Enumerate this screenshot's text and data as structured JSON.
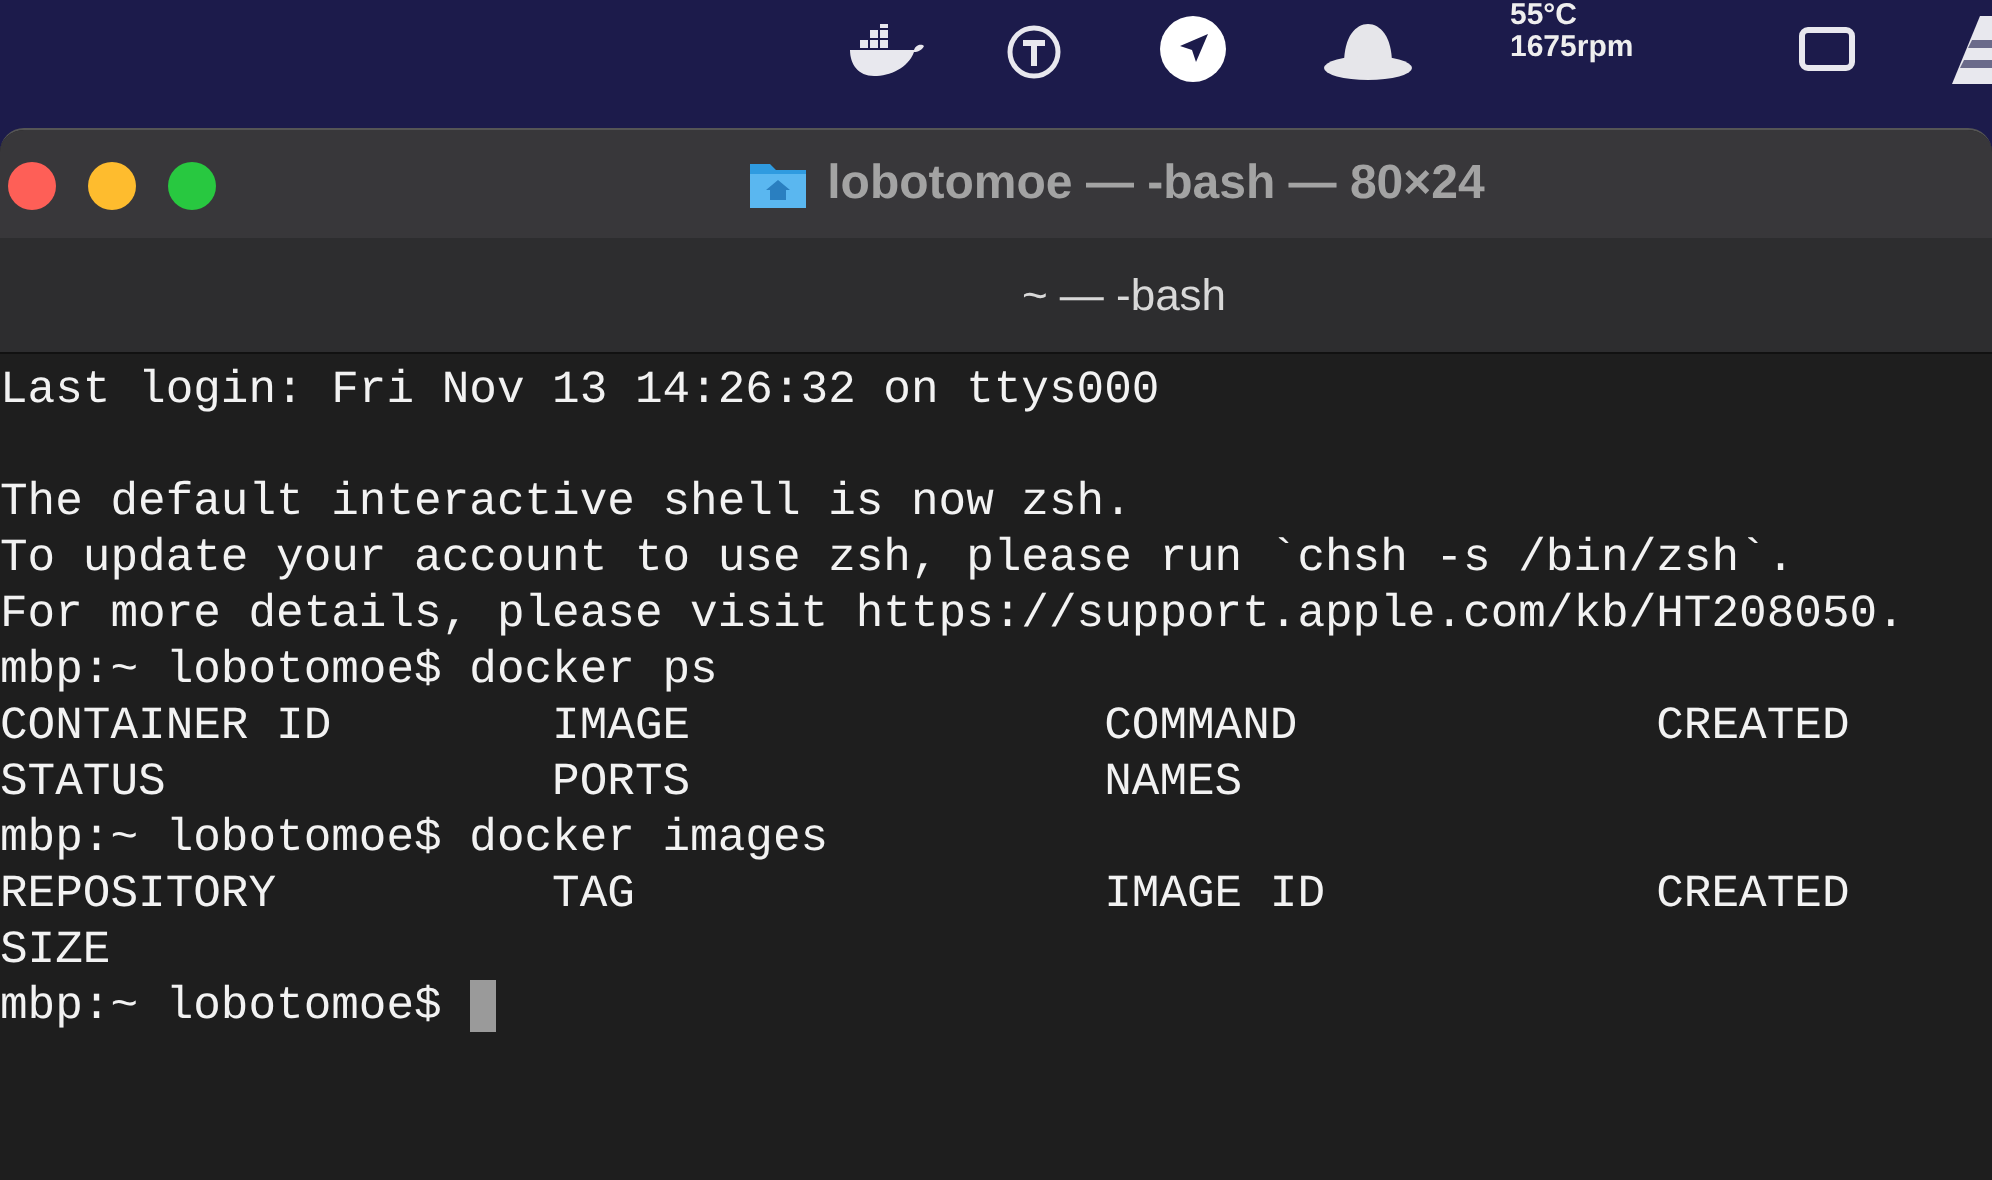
{
  "menu_bar": {
    "temperature": "55°C",
    "fan_speed": "1675rpm"
  },
  "window": {
    "title": "lobotomoe — -bash — 80×24",
    "tab": "~ — -bash"
  },
  "terminal": {
    "lines": [
      {
        "kind": "text",
        "text": "Last login: Fri Nov 13 14:26:32 on ttys000"
      },
      {
        "kind": "blank"
      },
      {
        "kind": "text",
        "text": "The default interactive shell is now zsh."
      },
      {
        "kind": "text",
        "text": "To update your account to use zsh, please run `chsh -s /bin/zsh`."
      },
      {
        "kind": "text",
        "text": "For more details, please visit https://support.apple.com/kb/HT208050."
      },
      {
        "kind": "text",
        "text": "mbp:~ lobotomoe$ docker ps"
      },
      {
        "kind": "text",
        "text": "CONTAINER ID        IMAGE               COMMAND             CREATED"
      },
      {
        "kind": "text",
        "text": "STATUS              PORTS               NAMES"
      },
      {
        "kind": "text",
        "text": "mbp:~ lobotomoe$ docker images"
      },
      {
        "kind": "text",
        "text": "REPOSITORY          TAG                 IMAGE ID            CREATED"
      },
      {
        "kind": "text",
        "text": "SIZE"
      }
    ],
    "prompt": "mbp:~ lobotomoe$ "
  }
}
